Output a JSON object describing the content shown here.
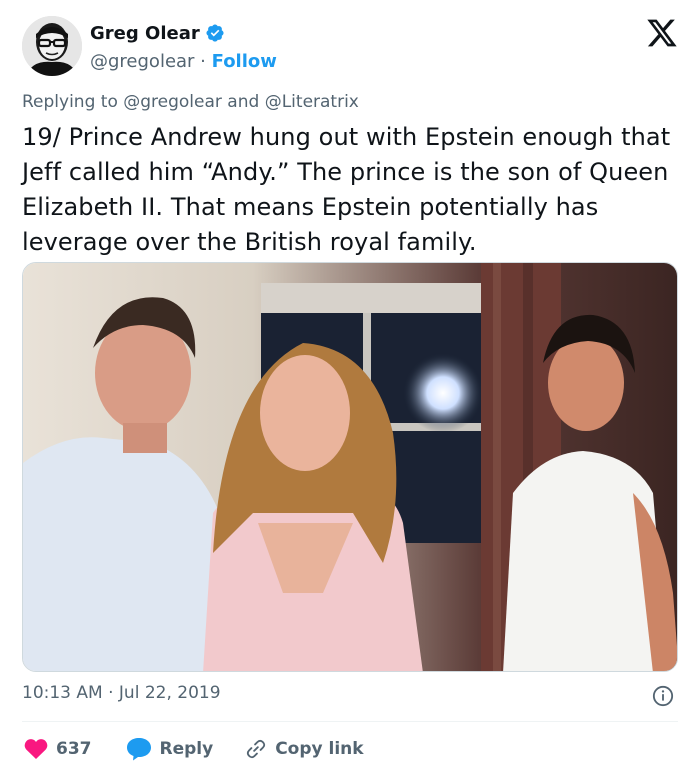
{
  "author": {
    "name": "Greg Olear",
    "handle": "@gregolear",
    "separator": " · ",
    "follow_label": "Follow"
  },
  "reply_context": {
    "prefix": "Replying to ",
    "mention1": "@gregolear",
    "joiner": " and ",
    "mention2": "@Literatrix"
  },
  "tweet": {
    "text": "19/ Prince Andrew hung out with Epstein enough that Jeff called him “Andy.” The prince is the son of Queen Elizabeth II. That means Epstein potentially has leverage over the British royal family.",
    "timestamp": "10:13 AM · Jul 22, 2019"
  },
  "actions": {
    "like_count": "637",
    "reply_label": "Reply",
    "copy_link_label": "Copy link"
  },
  "icons": {
    "verified": "verified-badge-icon",
    "x_logo": "x-logo-icon",
    "info": "info-icon",
    "heart": "heart-icon",
    "reply": "reply-bubble-icon",
    "link": "link-icon"
  },
  "colors": {
    "accent": "#1d9bf0",
    "like": "#f91880",
    "text": "#0f1419",
    "secondary": "#536471"
  }
}
